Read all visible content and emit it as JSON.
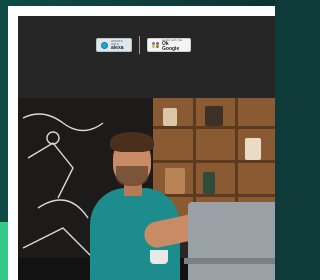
{
  "header": {
    "alexa_badge": {
      "small_text": "WORKS WITH",
      "brand": "alexa"
    },
    "google_badge": {
      "small_text": "works with the",
      "brand": "Ok Google"
    }
  },
  "hero": {
    "image": "man-smiling-at-laptop-in-cafe"
  },
  "colors": {
    "page_background": "#0e3b3a",
    "card_background": "#ffffff",
    "header_background": "#262626",
    "accent_green": "#34c987"
  }
}
